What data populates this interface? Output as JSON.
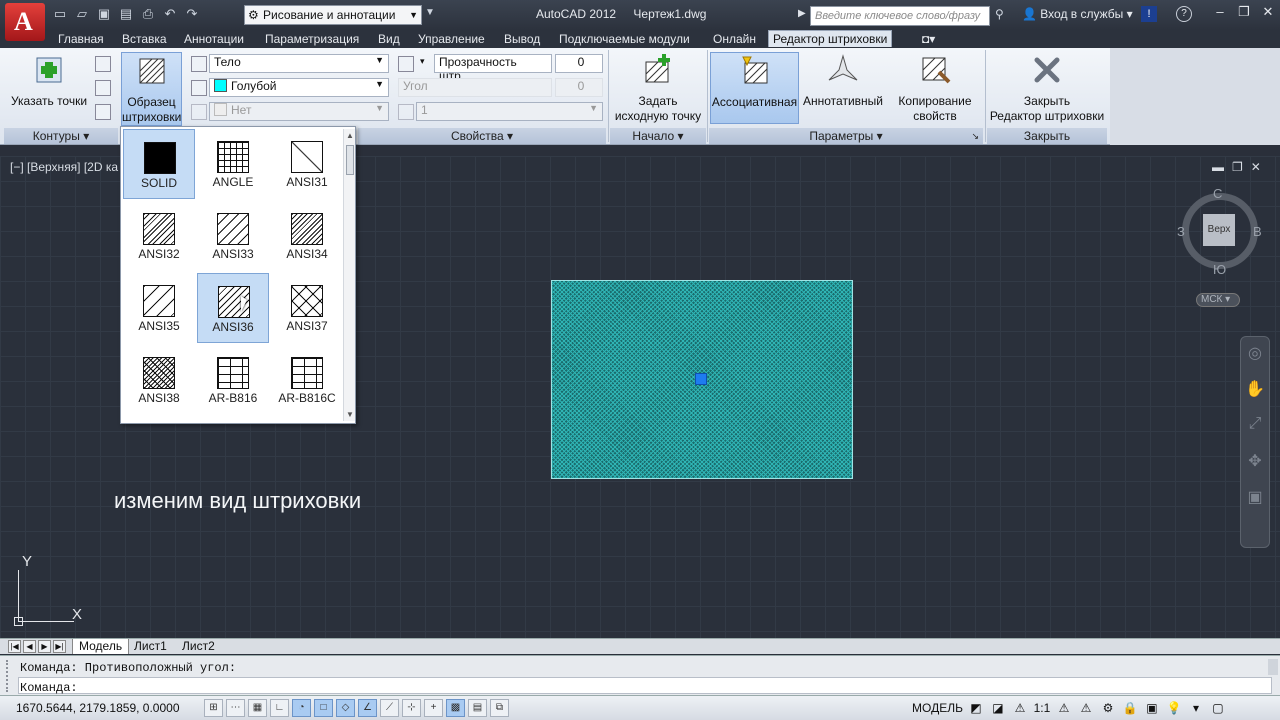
{
  "titlebar": {
    "workspace": "Рисование и аннотации",
    "app_name": "AutoCAD 2012",
    "document": "Чертеж1.dwg",
    "search_placeholder": "Введите ключевое слово/фразу",
    "signin": "Вход в службы"
  },
  "tabs": [
    "Главная",
    "Вставка",
    "Аннотации",
    "Параметризация",
    "Вид",
    "Управление",
    "Вывод",
    "Подключаемые модули",
    "Онлайн",
    "Редактор штриховки"
  ],
  "active_tab": "Редактор штриховки",
  "ribbon": {
    "pick_points": "Указать точки",
    "pattern_btn": "Образец\nштриховки",
    "pattern_btn_l1": "Образец",
    "pattern_btn_l2": "штриховки",
    "hatch_type": "Тело",
    "hatch_color": "Голубой",
    "hatch_color_hex": "#00ffff",
    "background": "Нет",
    "transparency_label": "Прозрачность штр...",
    "transparency_value": "0",
    "angle_label": "Угол",
    "angle_value": "0",
    "scale_value": "1",
    "set_origin_l1": "Задать",
    "set_origin_l2": "исходную точку",
    "associative": "Ассоциативная",
    "annotative": "Аннотативный",
    "match_props_l1": "Копирование",
    "match_props_l2": "свойств",
    "close_l1": "Закрыть",
    "close_l2": "Редактор штриховки",
    "panels": {
      "boundaries": "Контуры",
      "properties": "Свойства",
      "origin": "Начало",
      "options": "Параметры",
      "close": "Закрыть"
    }
  },
  "gallery": {
    "patterns": [
      "SOLID",
      "ANGLE",
      "ANSI31",
      "ANSI32",
      "ANSI33",
      "ANSI34",
      "ANSI35",
      "ANSI36",
      "ANSI37",
      "ANSI38",
      "AR-B816",
      "AR-B816C"
    ],
    "selected": [
      "SOLID",
      "ANSI36"
    ]
  },
  "viewport": {
    "label": "[−] [Верхняя] [2D ка",
    "caption": "изменим вид штриховки",
    "viewcube": {
      "face": "Верх",
      "north": "С",
      "south": "Ю",
      "east": "В",
      "west": "З",
      "ucs": "МСК"
    },
    "ucs_x": "X",
    "ucs_y": "Y",
    "hatch_color_hex": "#1a6b6c"
  },
  "layout_tabs": [
    "Модель",
    "Лист1",
    "Лист2"
  ],
  "command": {
    "history": "Команда: Противоположный угол:",
    "prompt": "Команда:"
  },
  "status": {
    "coords": "1670.5644, 2179.1859, 0.0000",
    "model": "МОДЕЛЬ",
    "scale": "1:1"
  }
}
